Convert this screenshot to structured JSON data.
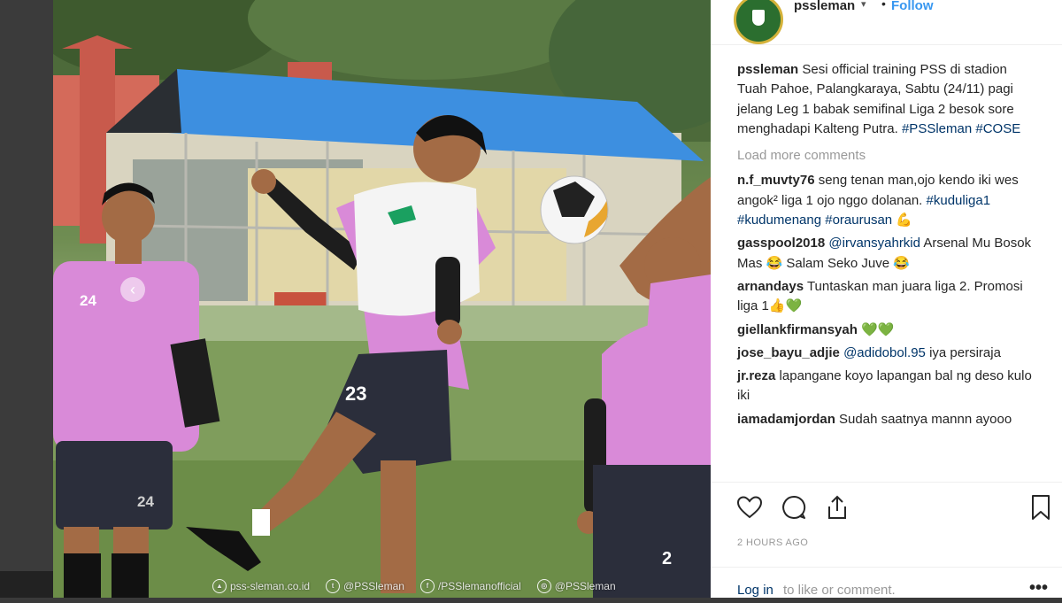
{
  "header": {
    "username": "pssleman",
    "caret": "▾",
    "dot": "•",
    "follow_label": "Follow"
  },
  "caption": {
    "username": "pssleman",
    "text": "Sesi official training PSS di stadion Tuah Pahoe, Palangkaraya, Sabtu (24/11) pagi jelang Leg 1 babak semifinal Liga 2 besok sore menghadapi Kalteng Putra.",
    "tag1": "#PSSleman",
    "tag2": "#COSE"
  },
  "load_more": "Load more comments",
  "comments": {
    "c1": {
      "user": "n.f_muvty76",
      "text": "seng tenan man,ojo kendo iki wes angok² liga 1 ojo nggo dolanan.",
      "tags": "#kuduliga1 #kudumenang #oraurusan",
      "emoji": "💪"
    },
    "c2": {
      "user": "gasspool2018",
      "mention": "@irvansyahrkid",
      "text": "Arsenal Mu Bosok Mas 😂 Salam Seko Juve 😂"
    },
    "c3": {
      "user": "arnandays",
      "text": "Tuntaskan man juara liga 2. Promosi liga 1👍💚"
    },
    "c4": {
      "user": "giellankfirmansyah",
      "text": "💚💚"
    },
    "c5": {
      "user": "jose_bayu_adjie",
      "mention": "@adidobol.95",
      "text": "iya persiraja"
    },
    "c6": {
      "user": "jr.reza",
      "text": "lapangane koyo lapangan bal ng deso kulo iki"
    },
    "c7": {
      "user": "iamadamjordan",
      "text": "Sudah saatnya mannn ayooo"
    }
  },
  "timestamp": "2 HOURS AGO",
  "login": {
    "link": "Log in",
    "rest": "to like or comment."
  },
  "more": "•••",
  "photo": {
    "jersey_numbers": {
      "p1": "24",
      "p1_shorts": "24",
      "p2": "23",
      "p4": "2"
    },
    "watermark": {
      "site": "pss-sleman.co.id",
      "twitter": "@PSSleman",
      "facebook": "/PSSlemanofficial",
      "instagram": "@PSSleman"
    },
    "prev_arrow": "‹",
    "next_arrow": "›"
  },
  "icons": [
    "heart-icon",
    "comment-icon",
    "share-icon",
    "bookmark-icon"
  ],
  "colors": {
    "link": "#003569",
    "follow": "#3897f0",
    "jersey": "#d98ad8",
    "roof": "#3d8fe0"
  }
}
